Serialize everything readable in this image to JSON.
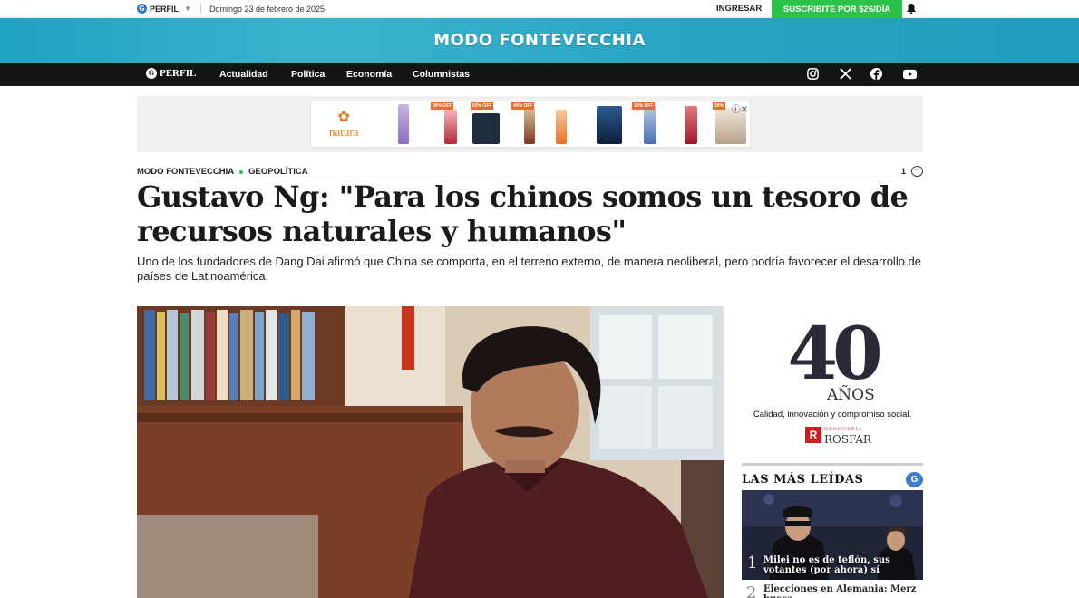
{
  "topbar": {
    "brand": "PERFIL",
    "date": "Domingo 23 de febrero de 2025",
    "login": "INGRESAR",
    "subscribe": "SUSCRIBITE POR $26/DÍA"
  },
  "banner": {
    "title": "MODO FONTEVECCHIA"
  },
  "nav": {
    "logo": "PERFIL",
    "items": [
      "Actualidad",
      "Política",
      "Economía",
      "Columnistas"
    ],
    "social": [
      "instagram-icon",
      "x-icon",
      "facebook-icon",
      "youtube-icon"
    ]
  },
  "ad": {
    "brand": "natura",
    "badges": [
      "30% OFF",
      "50% OFF",
      "40% OFF",
      "30% OFF",
      "30%"
    ]
  },
  "article": {
    "section": "MODO FONTEVECCHIA",
    "subsection": "GEOPOLÍTICA",
    "comments": "1",
    "headline": "Gustavo Ng: \"Para los chinos somos un tesoro de recursos naturales y humanos\"",
    "lead": "Uno de los fundadores de Dang Dai afirmó que China se comporta, en el terreno externo, de manera neoliberal, pero podría favorecer el desarrollo de países de Latinoamérica."
  },
  "sidebar_ad": {
    "number": "40",
    "years": "AÑOS",
    "tagline": "Calidad, innovación y compromiso social.",
    "brand_small": "DROGUERÍA",
    "brand": "ROSFAR"
  },
  "most_read": {
    "title": "LAS MÁS LEÍDAS",
    "items": [
      {
        "num": "1",
        "title": "Milei no es de teflón, sus votantes (por ahora) sí"
      },
      {
        "num": "2",
        "title": "Elecciones en Alemania: Merz busca"
      }
    ]
  },
  "colors": {
    "accent_green": "#2bc24a",
    "banner_blue": "#2aa6c4",
    "nav_black": "#141414"
  }
}
